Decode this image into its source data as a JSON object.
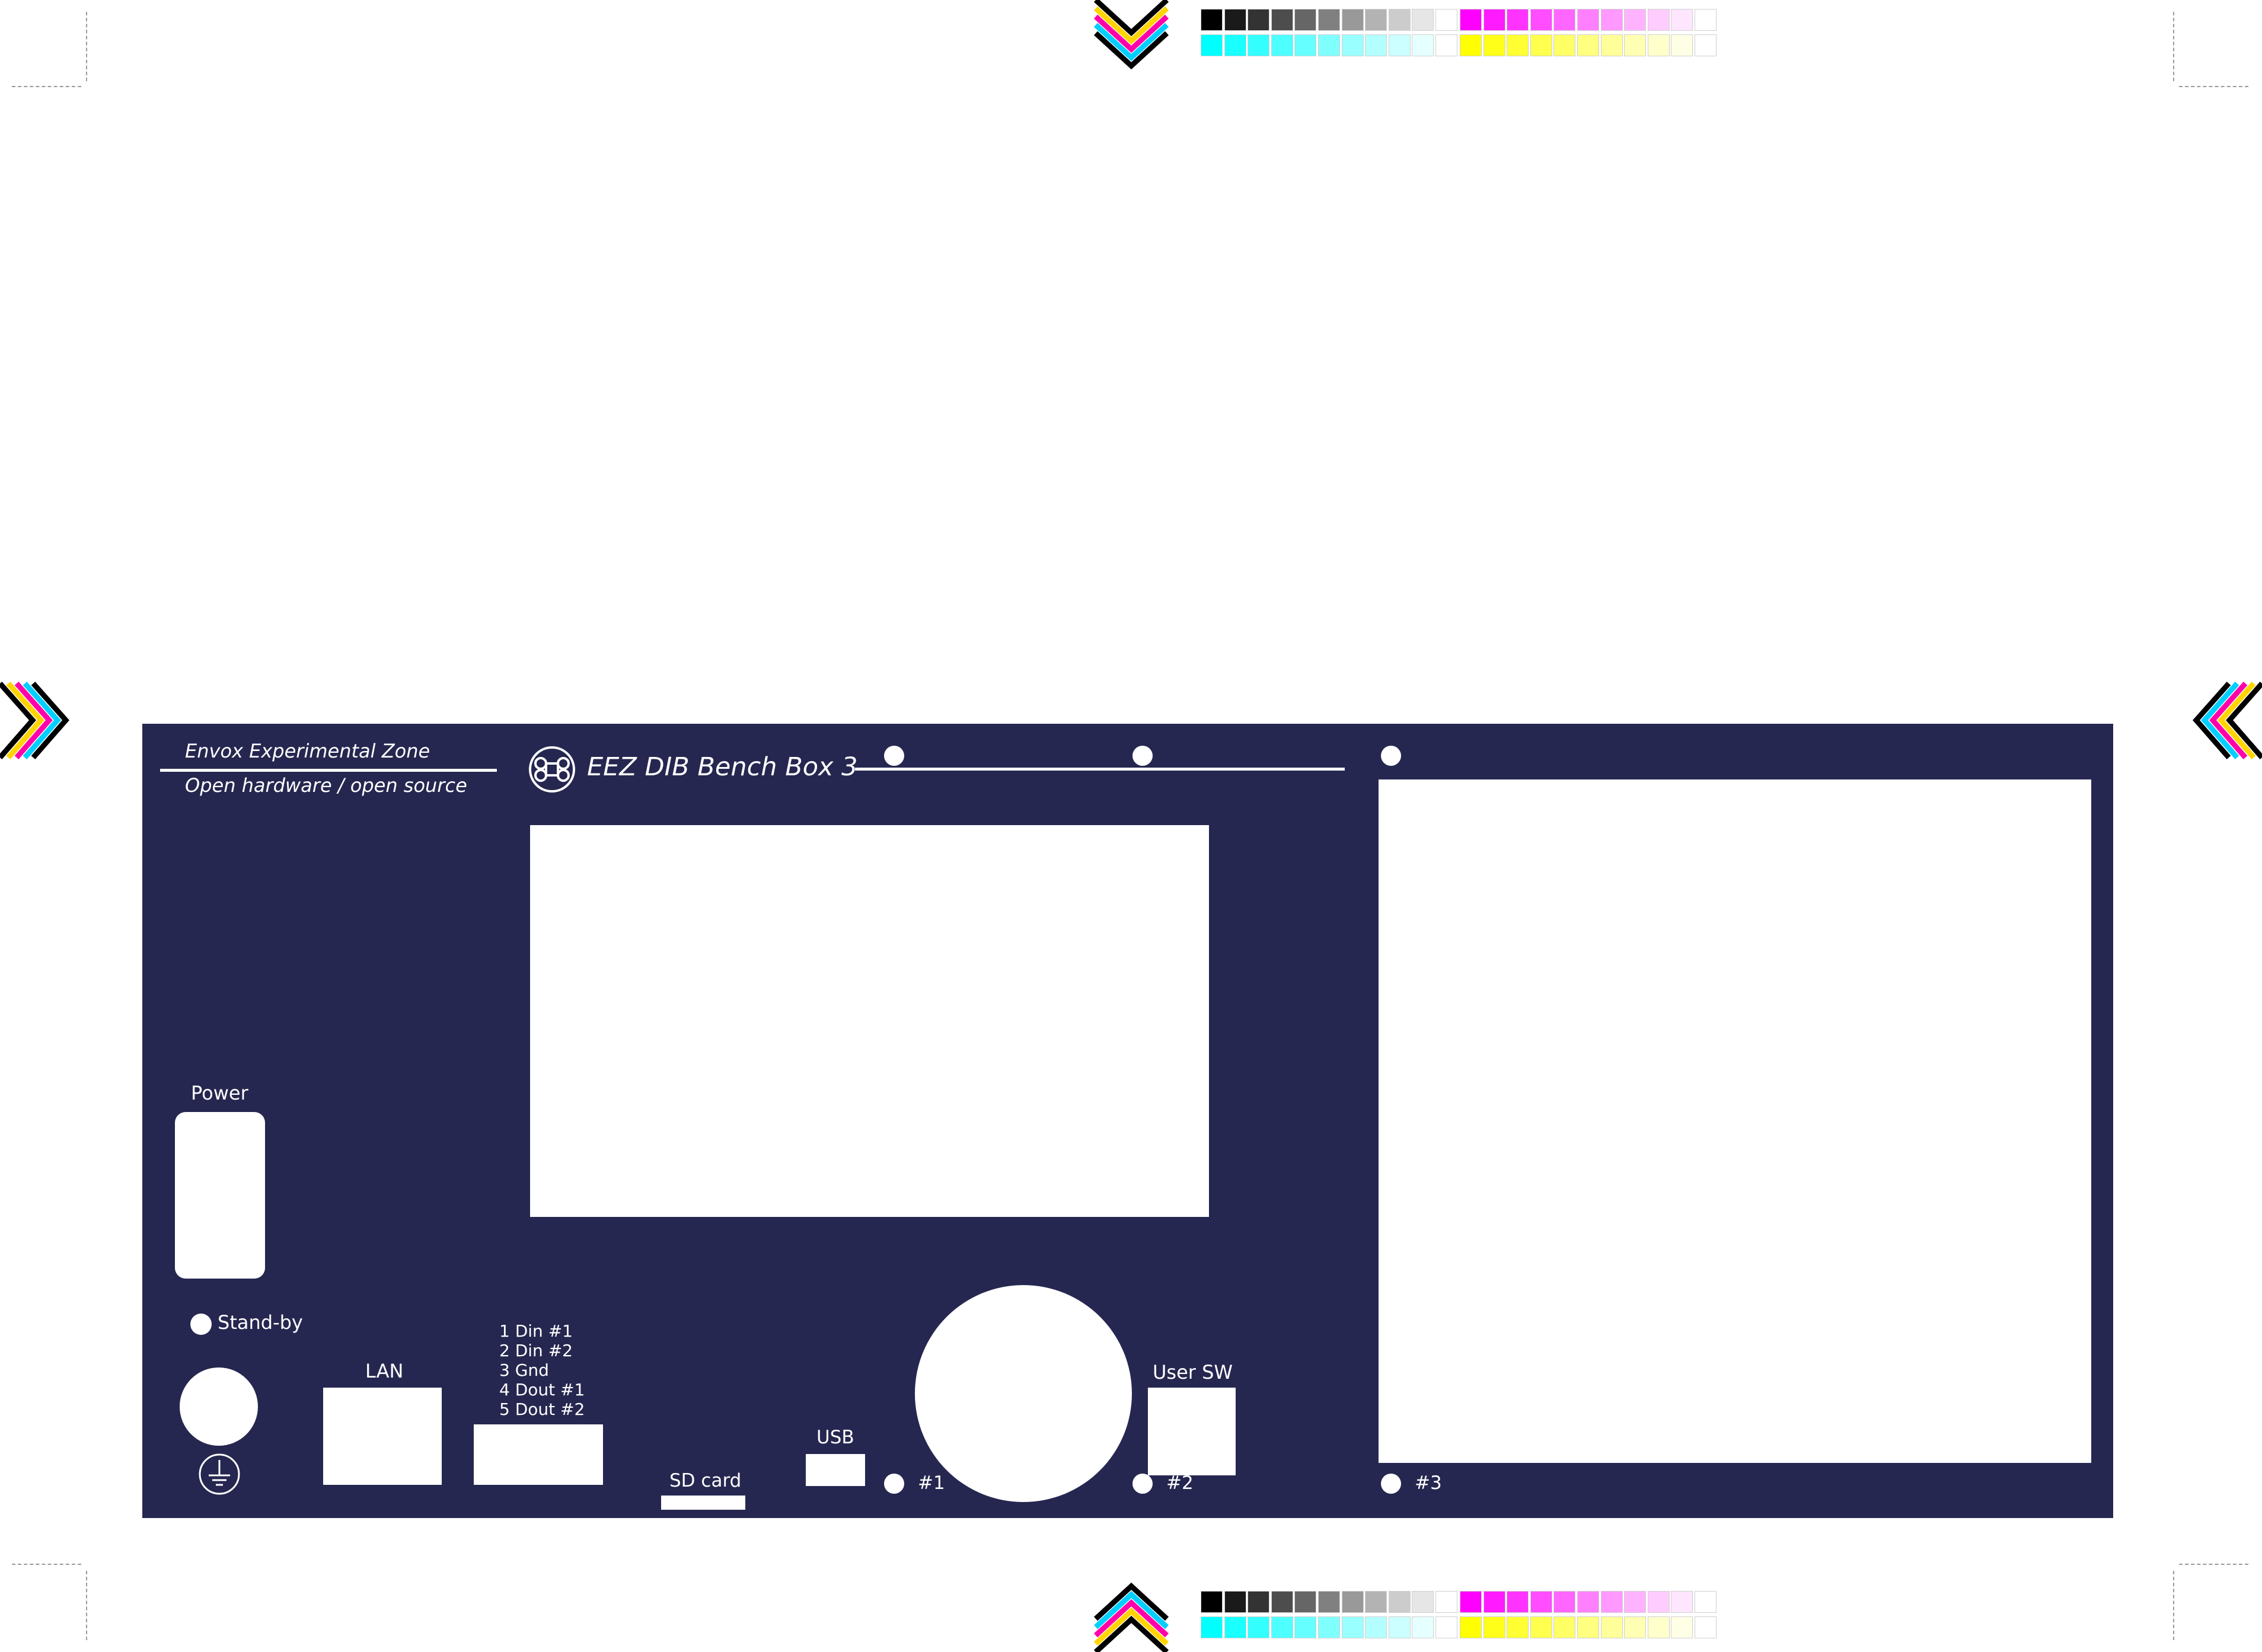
{
  "panel": {
    "title": "EEZ DIB Bench Box 3",
    "brand_line1": "Envox Experimental Zone",
    "brand_line2": "Open hardware / open source",
    "logo_icon": "cmd-key-logo-icon",
    "background_color": "#262750",
    "labels": {
      "power": "Power",
      "standby": "Stand-by",
      "lan": "LAN",
      "din": [
        "1 Din #1",
        "2 Din #2",
        "3 Gnd",
        "4 Dout #1",
        "5 Dout #2"
      ],
      "sd_card": "SD card",
      "usb": "USB",
      "user_sw": "User SW",
      "slots": [
        "#1",
        "#2",
        "#3"
      ]
    },
    "ground_icon": "ground-symbol-icon"
  },
  "print_marks": {
    "registration_icon": "registration-chevron-icon",
    "gray_ramp": [
      "#000000",
      "#1a1a1a",
      "#333333",
      "#4d4d4d",
      "#666666",
      "#808080",
      "#999999",
      "#b3b3b3",
      "#cccccc",
      "#e6e6e6",
      "#ffffff"
    ],
    "magenta_ramp": [
      "#ff00ff",
      "#ff1aff",
      "#ff33ff",
      "#ff4dff",
      "#ff66ff",
      "#ff80ff",
      "#ff99ff",
      "#ffb3ff",
      "#ffccff",
      "#ffe6ff",
      "#ffffff"
    ],
    "cyan_ramp": [
      "#00ffff",
      "#1affff",
      "#33ffff",
      "#4dffff",
      "#66ffff",
      "#80ffff",
      "#99ffff",
      "#b3ffff",
      "#ccffff",
      "#e6ffff",
      "#ffffff"
    ],
    "yellow_ramp": [
      "#ffff00",
      "#ffff1a",
      "#ffff33",
      "#ffff4d",
      "#ffff66",
      "#ffff80",
      "#ffff99",
      "#ffffb3",
      "#ffffcc",
      "#ffffe6",
      "#ffffff"
    ]
  }
}
